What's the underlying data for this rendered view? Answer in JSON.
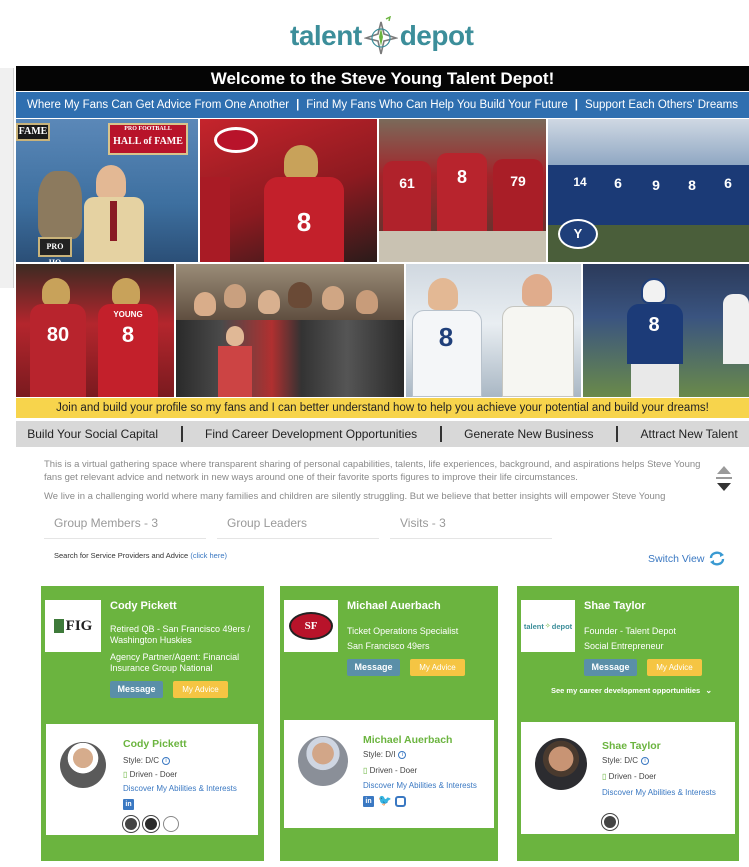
{
  "logo": {
    "part1": "talent",
    "part2": "depot"
  },
  "banner": {
    "title": "Welcome to the Steve Young Talent Depot!"
  },
  "nav": [
    "Where My Fans Can Get Advice From One Another",
    "Find My Fans Who Can Help You Build Your Future",
    "Support Each Others' Dreams"
  ],
  "photos": {
    "hof_sign_top": "FAME",
    "hof_sign_main_1": "PRO FOOTBALL",
    "hof_sign_main_2": "HALL of FAME",
    "hof_sign_bottom": "PRO HO",
    "ph2_jersey": "8",
    "ph3_jerseys": [
      "61",
      "8",
      "79"
    ],
    "ph4_jerseys": [
      "14",
      "6",
      "9",
      "8",
      "6"
    ],
    "ph4_logo": "Y",
    "ph5_jerseys": [
      "80",
      "YOUNG",
      "8"
    ],
    "ph7_jersey": "8",
    "ph8_jersey": "8"
  },
  "tagline": "Join and build your profile so my fans and I can better understand how to help you achieve your potential and build your dreams!",
  "capabilities": [
    "Build Your Social Capital",
    "Find Career Development Opportunities",
    "Generate New Business",
    "Attract New Talent"
  ],
  "description": {
    "p1": "This is a virtual gathering space where transparent sharing of personal capabilities, talents, life experiences, background, and aspirations helps Steve Young fans get relevant advice and network in new ways around one of their favorite sports figures to improve their life circumstances.",
    "p2": "We live in a challenging world where many families and children are silently struggling. But we believe that better insights will empower Steve Young"
  },
  "stats": {
    "members": "Group Members - 3",
    "leaders": "Group Leaders",
    "visits": "Visits - 3"
  },
  "search": {
    "text": "Search for Service Providers and Advice",
    "link": "(click here)"
  },
  "switch_view": "Switch View",
  "cards": [
    {
      "logo": "FIG",
      "name": "Cody Pickett",
      "lines": [
        "Retired QB - San Francisco 49ers /",
        "Washington Huskies",
        "Agency Partner/Agent: Financial",
        "Insurance Group National"
      ],
      "message": "Message",
      "advice": "My Advice",
      "inner_name": "Cody Pickett",
      "style": "Style: D/C",
      "driven": "Driven - Doer",
      "discover": "Discover My Abilities & Interests",
      "social_li": "in"
    },
    {
      "logo": "SF",
      "name": "Michael Auerbach",
      "lines": [
        "Ticket Operations Specialist",
        "San Francisco 49ers"
      ],
      "message": "Message",
      "advice": "My Advice",
      "inner_name": "Michael Auerbach",
      "style": "Style: D/I",
      "driven": "Driven - Doer",
      "discover": "Discover My Abilities & Interests",
      "social_li": "in",
      "social_tw": "🐦"
    },
    {
      "logo_part1": "talent",
      "logo_part2": "depot",
      "name": "Shae Taylor",
      "lines": [
        "Founder - Talent Depot",
        "Social Entrepreneur"
      ],
      "message": "Message",
      "advice": "My Advice",
      "see_more": "See my career development opportunities",
      "inner_name": "Shae Taylor",
      "style": "Style: D/C",
      "driven": "Driven - Doer",
      "discover": "Discover My Abilities & Interests"
    }
  ],
  "colors": {
    "green": "#6bb43f",
    "blue": "#2f6fb0",
    "yellow": "#f7d44c",
    "teal": "#3c8e9a"
  }
}
